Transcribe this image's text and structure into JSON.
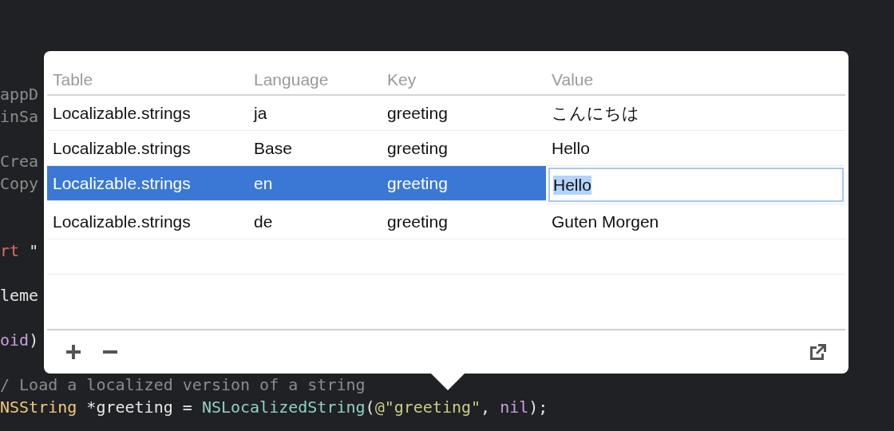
{
  "editor": {
    "lines": [
      {
        "kind": "code",
        "tokens": [
          {
            "text": "appD",
            "color": "#8c8c8c"
          }
        ]
      },
      {
        "kind": "code",
        "tokens": [
          {
            "text": "inSa",
            "color": "#8c8c8c"
          }
        ]
      },
      {
        "kind": "blank"
      },
      {
        "kind": "code",
        "tokens": [
          {
            "text": "Crea",
            "color": "#8c8c8c"
          }
        ]
      },
      {
        "kind": "code",
        "tokens": [
          {
            "text": "Copy",
            "color": "#8c8c8c"
          }
        ]
      },
      {
        "kind": "blank"
      },
      {
        "kind": "blank"
      },
      {
        "kind": "code",
        "tokens": [
          {
            "text": "rt",
            "color": "#e36a5f"
          },
          {
            "text": " \"",
            "color": "#e6e6e6"
          }
        ]
      },
      {
        "kind": "blank"
      },
      {
        "kind": "code",
        "tokens": [
          {
            "text": "leme",
            "color": "#e6e6e6"
          }
        ]
      },
      {
        "kind": "blank"
      },
      {
        "kind": "code",
        "tokens": [
          {
            "text": "oid",
            "color": "#c7a0d6"
          },
          {
            "text": ")",
            "color": "#e6e6e6"
          }
        ]
      },
      {
        "kind": "blank"
      },
      {
        "kind": "code",
        "tokens": [
          {
            "text": "/ Load a localized version of a string",
            "color": "#8c8c8c"
          }
        ]
      },
      {
        "kind": "code",
        "tokens": [
          {
            "text": "NSString",
            "color": "#f2c879"
          },
          {
            "text": " *greeting = ",
            "color": "#e6e6e6"
          },
          {
            "text": "NSLocalizedString",
            "color": "#8fd1c7"
          },
          {
            "text": "(",
            "color": "#e6e6e6"
          },
          {
            "text": "@\"greeting\"",
            "color": "#cdcd80"
          },
          {
            "text": ", ",
            "color": "#e6e6e6"
          },
          {
            "text": "nil",
            "color": "#c7a0d6"
          },
          {
            "text": ");",
            "color": "#e6e6e6"
          }
        ]
      }
    ]
  },
  "popover": {
    "table": {
      "columns": [
        "Table",
        "Language",
        "Key",
        "Value"
      ],
      "rows": [
        {
          "table": "Localizable.strings",
          "language": "ja",
          "key": "greeting",
          "value": "こんにちは",
          "selected": false,
          "editing": false
        },
        {
          "table": "Localizable.strings",
          "language": "Base",
          "key": "greeting",
          "value": "Hello",
          "selected": false,
          "editing": false
        },
        {
          "table": "Localizable.strings",
          "language": "en",
          "key": "greeting",
          "value": "Hello",
          "selected": true,
          "editing": true
        },
        {
          "table": "Localizable.strings",
          "language": "de",
          "key": "greeting",
          "value": "Guten Morgen",
          "selected": false,
          "editing": false
        }
      ]
    }
  }
}
